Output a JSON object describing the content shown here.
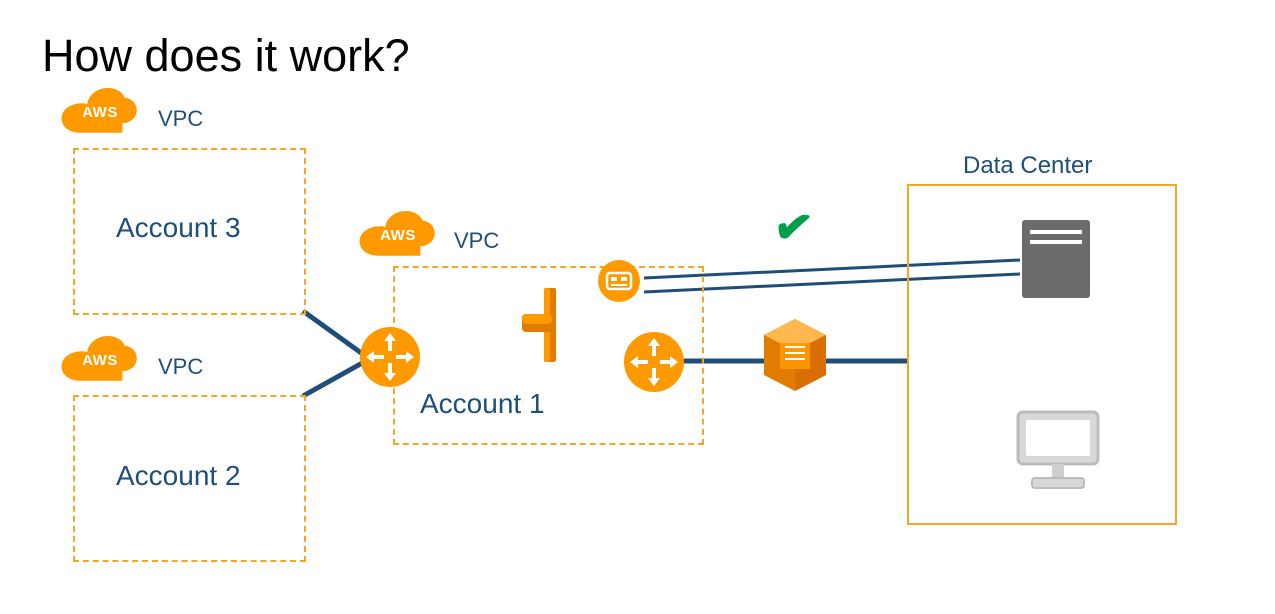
{
  "title": "How does it work?",
  "vpc3": {
    "cloud": "AWS",
    "label": "VPC",
    "account": "Account 3"
  },
  "vpc2": {
    "cloud": "AWS",
    "label": "VPC",
    "account": "Account 2"
  },
  "vpc1": {
    "cloud": "AWS",
    "label": "VPC",
    "account": "Account 1"
  },
  "datacenter": {
    "label": "Data Center"
  },
  "checkmark": "✔",
  "colors": {
    "aws_orange": "#ff9900",
    "navy": "#1f4e79",
    "line": "#1f4e79",
    "green": "#009e49",
    "grey_server": "#6b6b6b",
    "grey_pc": "#cfcfcf"
  }
}
